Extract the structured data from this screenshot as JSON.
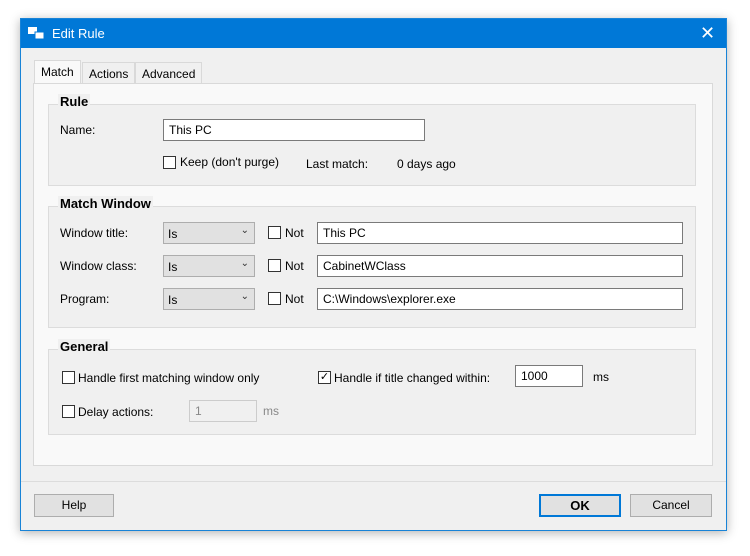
{
  "window": {
    "title": "Edit Rule",
    "close": "✕"
  },
  "tabs": [
    {
      "label": "Match"
    },
    {
      "label": "Actions"
    },
    {
      "label": "Advanced"
    }
  ],
  "rule": {
    "heading": "Rule",
    "name_label": "Name:",
    "name_value": "This PC",
    "keep_label": "Keep (don't purge)",
    "keep_checked": false,
    "last_match_label": "Last match:",
    "last_match_value": "0 days ago"
  },
  "match_window": {
    "heading": "Match Window",
    "rows": [
      {
        "label": "Window title:",
        "op": "Is",
        "not_label": "Not",
        "value": "This PC"
      },
      {
        "label": "Window class:",
        "op": "Is",
        "not_label": "Not",
        "value": "CabinetWClass"
      },
      {
        "label": "Program:",
        "op": "Is",
        "not_label": "Not",
        "value": "C:\\Windows\\explorer.exe"
      }
    ]
  },
  "general": {
    "heading": "General",
    "first_only_label": "Handle first matching window only",
    "title_changed_label": "Handle if title changed within:",
    "title_changed_value": "1000",
    "title_changed_unit": "ms",
    "delay_label": "Delay actions:",
    "delay_value": "1",
    "delay_unit": "ms"
  },
  "buttons": {
    "help": "Help",
    "ok": "OK",
    "cancel": "Cancel"
  }
}
